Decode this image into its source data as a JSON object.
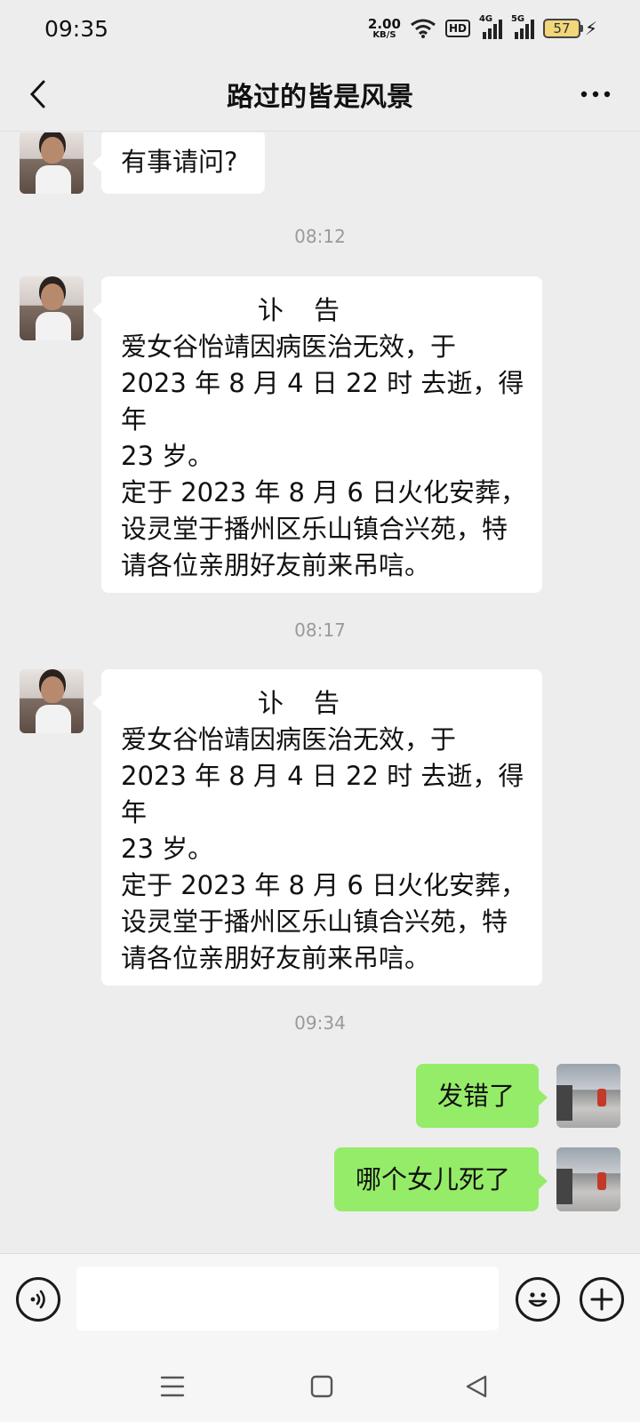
{
  "status_bar": {
    "time": "09:35",
    "speed_value": "2.00",
    "speed_unit": "KB/S",
    "hd_label": "HD",
    "signal1_label": "4G",
    "signal2_label": "5G",
    "battery": "57"
  },
  "header": {
    "title": "路过的皆是风景"
  },
  "messages": {
    "m1": "有事请问?",
    "t1": "08:12",
    "notice1": {
      "title": "讣告",
      "lines": [
        "爱女谷怡靖因病医治无效，于",
        "2023 年 8 月 4 日 22 时 去逝，得年",
        "23 岁。",
        "定于 2023 年 8 月 6 日火化安葬，",
        "设灵堂于播州区乐山镇合兴苑，特",
        "请各位亲朋好友前来吊唁。"
      ]
    },
    "t2": "08:17",
    "notice2": {
      "title": "讣告",
      "lines": [
        "爱女谷怡靖因病医治无效，于",
        "2023 年 8 月 4 日 22 时 去逝，得年",
        "23 岁。",
        "定于 2023 年 8 月 6 日火化安葬，",
        "设灵堂于播州区乐山镇合兴苑，特",
        "请各位亲朋好友前来吊唁。"
      ]
    },
    "t3": "09:34",
    "m2": "发错了",
    "m3": "哪个女儿死了"
  },
  "input_bar": {
    "placeholder": ""
  },
  "icons": {
    "back": "chevron-left-icon",
    "more": "more-dots-icon",
    "voice": "voice-icon",
    "emoji": "emoji-icon",
    "add": "plus-icon"
  },
  "colors": {
    "background": "#ededed",
    "incoming_bubble": "#ffffff",
    "outgoing_bubble": "#95ec69"
  }
}
